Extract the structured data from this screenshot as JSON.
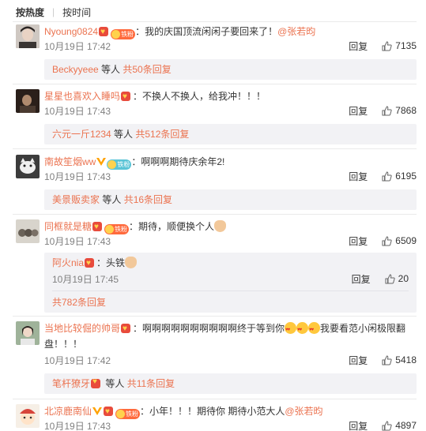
{
  "tabs": {
    "hot": "按热度",
    "time": "按时间"
  },
  "reply_label": "回复",
  "comments": [
    {
      "user": "Nyoung0824",
      "text": "：我的庆国顶流闲闲子要回来了！",
      "mention": "@张若昀",
      "time": "10月19日 17:42",
      "likes": "7135",
      "summary_user": "Beckyyeee",
      "summary_mid": " 等人 ",
      "summary_link": "共50条回复"
    },
    {
      "user": "星星也喜欢入睡吗",
      "text": "：不换人不换人，给我冲！！！",
      "time": "10月19日 17:43",
      "likes": "7868",
      "summary_user": "六元一斤1234",
      "summary_mid": " 等人 ",
      "summary_link": "共512条回复"
    },
    {
      "user": "南故笙烟ww",
      "text": "：啊啊啊期待庆余年2!",
      "time": "10月19日 17:43",
      "likes": "6195",
      "summary_user": "美景贩卖家",
      "summary_mid": " 等人 ",
      "summary_link": "共16条回复"
    },
    {
      "user": "同框就是糖",
      "text": "：期待，顺便换个人",
      "time": "10月19日 17:43",
      "likes": "6509",
      "sub_user": "阿火nia",
      "sub_text": "：头铁",
      "sub_time": "10月19日 17:45",
      "sub_likes": "20",
      "summary_link": "共782条回复"
    },
    {
      "user": "当地比较倔的帅哥",
      "text_line1": "：啊啊啊啊啊啊啊啊啊啊终于等到你",
      "text_line1b": "我要看范小闲极限翻",
      "text_line2": "盘！！！",
      "time": "10月19日 17:42",
      "likes": "5418",
      "summary_user": "笔杆獠牙",
      "summary_mid": " 等人 ",
      "summary_link": "共11条回复"
    },
    {
      "user": "北凉鹿南仙",
      "text": "：小年！！！期待你  期待小范大人",
      "mention": "@张若昀",
      "time": "10月19日 17:43",
      "likes": "4897"
    }
  ],
  "icons": {
    "like": "thumb-up-icon",
    "verified": "verified-v-icon",
    "fan": "fan-medal-icon"
  },
  "colors": {
    "link": "#eb7350",
    "muted": "#808080",
    "reply_bg": "#f2f2f5"
  }
}
